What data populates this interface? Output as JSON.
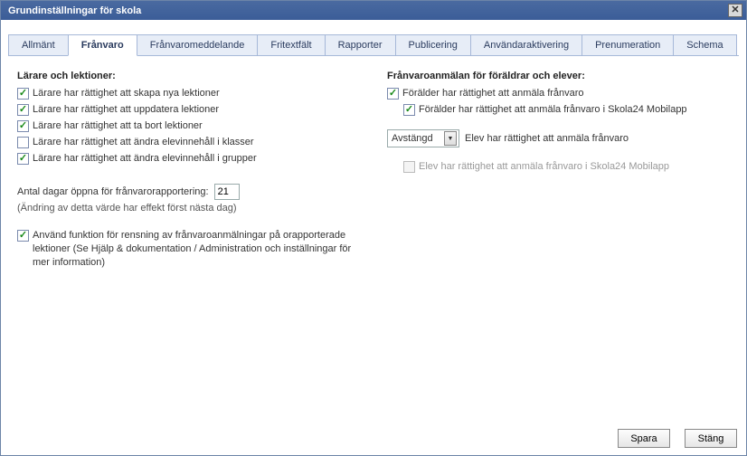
{
  "window": {
    "title": "Grundinställningar för skola"
  },
  "tabs": [
    {
      "label": "Allmänt"
    },
    {
      "label": "Frånvaro"
    },
    {
      "label": "Frånvaromeddelande"
    },
    {
      "label": "Fritextfält"
    },
    {
      "label": "Rapporter"
    },
    {
      "label": "Publicering"
    },
    {
      "label": "Användaraktivering"
    },
    {
      "label": "Prenumeration"
    },
    {
      "label": "Schema"
    }
  ],
  "active_tab": 1,
  "left": {
    "heading": "Lärare och lektioner:",
    "items": [
      {
        "label": "Lärare har rättighet att skapa nya lektioner",
        "checked": true
      },
      {
        "label": "Lärare har rättighet att uppdatera lektioner",
        "checked": true
      },
      {
        "label": "Lärare har rättighet att ta bort lektioner",
        "checked": true
      },
      {
        "label": "Lärare har rättighet att ändra elevinnehåll i klasser",
        "checked": false
      },
      {
        "label": "Lärare har rättighet att ändra elevinnehåll i grupper",
        "checked": true
      }
    ],
    "days_label": "Antal dagar öppna för frånvarorapportering:",
    "days_value": "21",
    "days_note": "(Ändring av detta värde har effekt först nästa dag)",
    "cleanup": {
      "label": "Använd funktion för rensning av frånvaroanmälningar på orapporterade lektioner (Se Hjälp & dokumentation / Administration och inställningar för mer information)",
      "checked": true
    }
  },
  "right": {
    "heading": "Frånvaroanmälan för föräldrar och elever:",
    "parent": {
      "label": "Förälder har rättighet att anmäla frånvaro",
      "checked": true
    },
    "parent_mobile": {
      "label": "Förälder har rättighet att anmäla frånvaro i Skola24 Mobilapp",
      "checked": true
    },
    "student_select": {
      "value": "Avstängd"
    },
    "student_label": "Elev har rättighet att anmäla frånvaro",
    "student_mobile": {
      "label": "Elev har rättighet att anmäla frånvaro i Skola24 Mobilapp",
      "checked": false,
      "disabled": true
    }
  },
  "footer": {
    "save": "Spara",
    "close": "Stäng"
  }
}
